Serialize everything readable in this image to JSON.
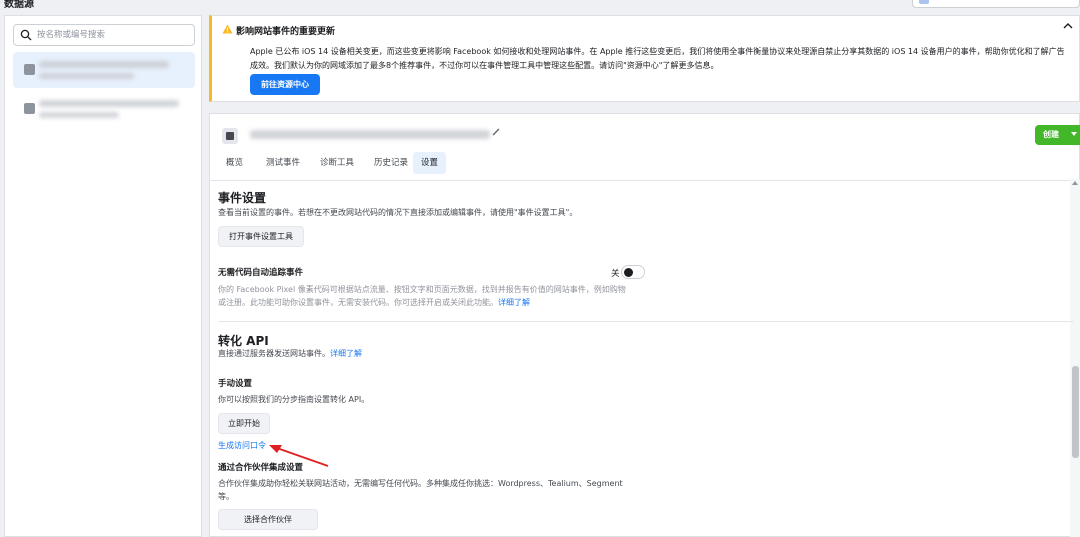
{
  "app": {
    "title": "数据源"
  },
  "sidebar": {
    "search_placeholder": "按名称或编号搜索"
  },
  "banner": {
    "title": "影响网站事件的重要更新",
    "body_line1": "Apple 已公布 iOS 14 设备相关变更，而这些变更将影响 Facebook 如何接收和处理网站事件。在 Apple 推行这些变更后，我们将使用全事件衡量协议来处理源自禁止分享其数据的 iOS 14 设备用户的事件，帮助你优化和了解广告",
    "body_line2": "成效。我们默认为你的网域添加了最多8个推荐事件，不过你可以在事件管理工具中管理这些配置。请访问\"资源中心\"了解更多信息。",
    "button": "前往资源中心"
  },
  "header": {
    "create_button": "创建",
    "tabs": [
      {
        "label": "概览"
      },
      {
        "label": "测试事件"
      },
      {
        "label": "诊断工具"
      },
      {
        "label": "历史记录"
      },
      {
        "label": "设置"
      }
    ]
  },
  "event_setup": {
    "title": "事件设置",
    "desc": "查看当前设置的事件。若想在不更改网站代码的情况下直接添加或编辑事件，请使用\"事件设置工具\"。",
    "button": "打开事件设置工具"
  },
  "auto_tracking": {
    "title": "无需代码自动追踪事件",
    "toggle_label": "关",
    "desc_line1": "你的 Facebook Pixel 像素代码可根据站点流量、按钮文字和页面元数据，找到并报告有价值的网站事件，例如购物",
    "desc_line2": "或注册。此功能可助你设置事件，无需安装代码。你可选择开启或关闭此功能。",
    "link": "详细了解"
  },
  "conversion_api": {
    "title": "转化 API",
    "desc": "直接通过服务器发送网站事件。",
    "link": "详细了解",
    "manual": {
      "title": "手动设置",
      "desc": "你可以按照我们的分步指南设置转化 API。",
      "button": "立即开始",
      "token_link": "生成访问口令"
    },
    "partner": {
      "title": "通过合作伙伴集成设置",
      "desc_line1": "合作伙伴集成助你轻松关联网站活动，无需编写任何代码。多种集成任你挑选：Wordpress、Tealium、Segment",
      "desc_line2": "等。",
      "button": "选择合作伙伴"
    }
  },
  "colors": {
    "accent": "#1877f2",
    "create_green": "#42b72a",
    "warning": "#f7b928",
    "annotation_arrow": "#e02020"
  }
}
